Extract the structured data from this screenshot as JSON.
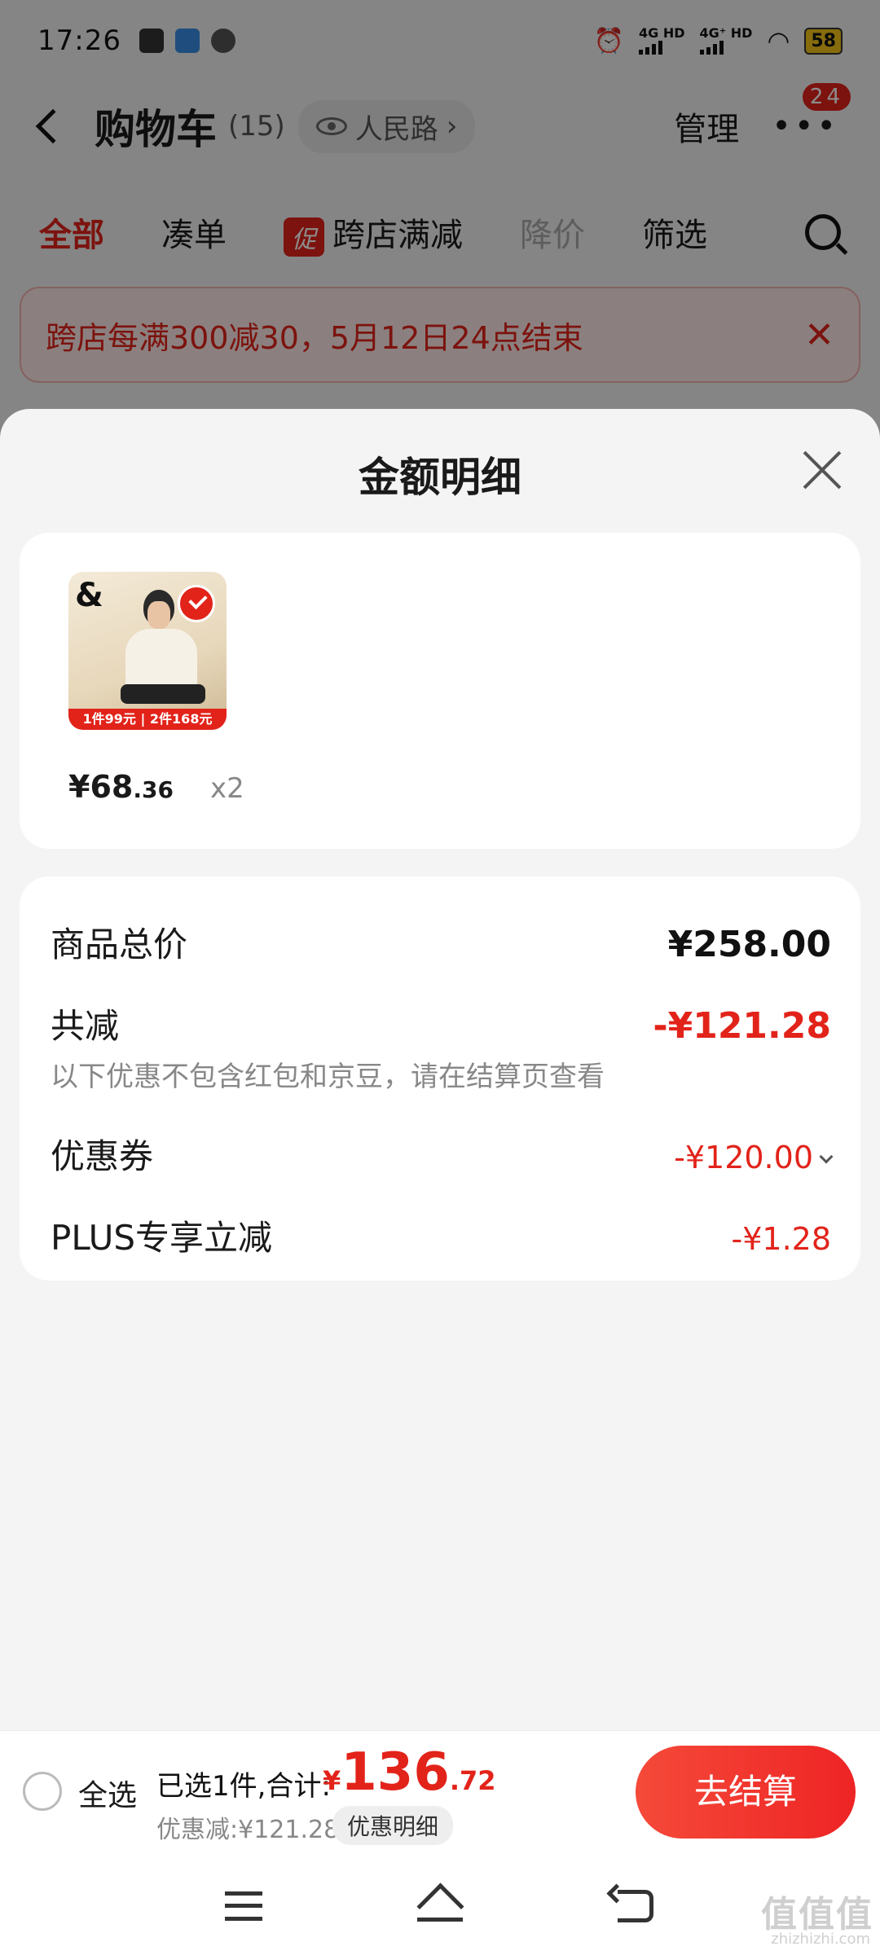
{
  "status_bar": {
    "time": "17:26",
    "network1": "4G HD",
    "network2": "4G⁺ HD",
    "battery": "58"
  },
  "header": {
    "title": "购物车",
    "count": "(15)",
    "location": "人民路",
    "manage": "管理",
    "more": "•••",
    "badge": "24"
  },
  "tabs": [
    {
      "label": "全部"
    },
    {
      "label": "凑单"
    },
    {
      "promo": "促",
      "label": "跨店满减"
    },
    {
      "label": "降价"
    },
    {
      "label": "筛选"
    }
  ],
  "notice": {
    "text": "跨店每满300减30，5月12日24点结束",
    "close": "✕"
  },
  "sheet": {
    "title": "金额明细",
    "product": {
      "logo": "&",
      "strip": "1件99元 | 2件168元",
      "price_int": "¥68",
      "price_dec": ".36",
      "qty": "x2"
    },
    "summary": {
      "total_label": "商品总价",
      "total_value": "¥258.00",
      "reduce_label": "共减",
      "reduce_value": "-¥121.28",
      "note": "以下优惠不包含红包和京豆，请在结算页查看",
      "coupon_label": "优惠券",
      "coupon_value": "-¥120.00",
      "plus_label": "PLUS专享立减",
      "plus_value": "-¥1.28"
    }
  },
  "checkout": {
    "select_all": "全选",
    "selected_text": "已选1件,合计:",
    "total_currency": "¥",
    "total_int": "136",
    "total_dec": ".72",
    "discount_text": "优惠减:¥121.28",
    "detail_chip": "优惠明细",
    "pay_button": "去结算"
  },
  "watermark": {
    "main": "值值值",
    "sub": "zhizhizhi.com"
  },
  "colors": {
    "accent": "#e2231a",
    "overlay": "rgba(0,0,0,0.45)"
  }
}
